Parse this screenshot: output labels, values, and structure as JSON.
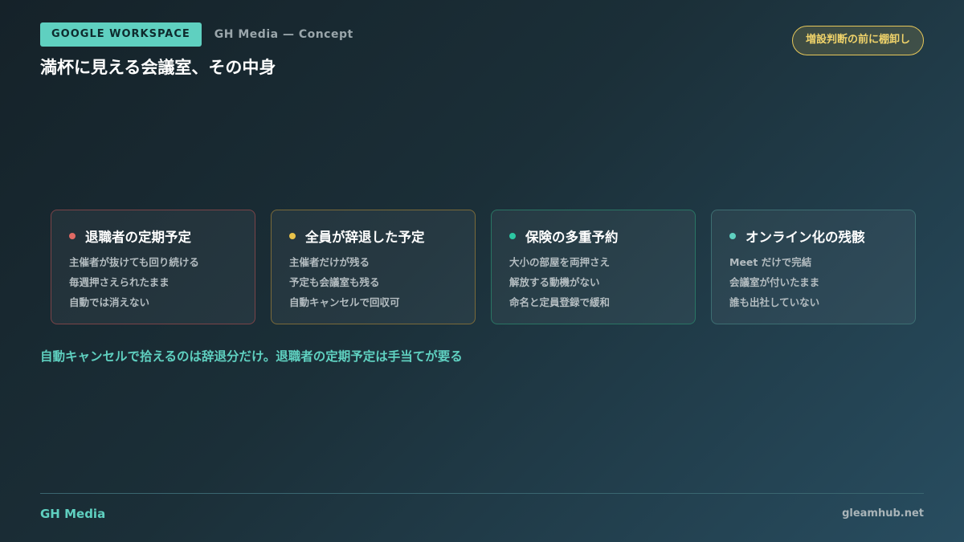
{
  "header": {
    "tag": "GOOGLE WORKSPACE",
    "subtitle": "GH Media — Concept",
    "title": "満杯に見える会議室、その中身",
    "badge": "増設判断の前に棚卸し"
  },
  "cards": [
    {
      "title": "退職者の定期予定",
      "dot_color": "#e06a64",
      "border_color": "#7a4448",
      "lines": [
        "主催者が抜けても回り続ける",
        "毎週押さえられたまま",
        "自動では消えない"
      ]
    },
    {
      "title": "全員が辞退した予定",
      "dot_color": "#e8c24a",
      "border_color": "#7a6a3a",
      "lines": [
        "主催者だけが残る",
        "予定も会議室も残る",
        "自動キャンセルで回収可"
      ]
    },
    {
      "title": "保険の多重予約",
      "dot_color": "#2cc7a3",
      "border_color": "#2a7564",
      "lines": [
        "大小の部屋を両押さえ",
        "解放する動機がない",
        "命名と定員登録で緩和"
      ]
    },
    {
      "title": "オンライン化の残骸",
      "dot_color": "#5fd0c0",
      "border_color": "#3d6e72",
      "lines": [
        "Meet だけで完結",
        "会議室が付いたまま",
        "誰も出社していない"
      ]
    }
  ],
  "summary": "自動キャンセルで拾えるのは辞退分だけ。退職者の定期予定は手当てが要る",
  "footer": {
    "left": "GH Media",
    "right": "gleamhub.net"
  }
}
